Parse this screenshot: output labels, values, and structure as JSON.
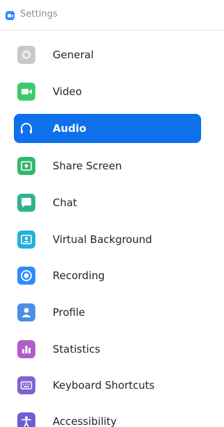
{
  "window": {
    "title": "Settings",
    "logo_icon": "zoom-camera-logo-icon"
  },
  "colors": {
    "accent": "#0e71eb",
    "general": "#c8c8c8",
    "video": "#3fc96a",
    "share_screen": "#33b96b",
    "chat": "#2fb38f",
    "virtual_background": "#24b0d8",
    "recording": "#2d8cff",
    "profile": "#4a90e2",
    "statistics": "#b05ec7",
    "keyboard_shortcuts": "#7f63d1",
    "accessibility": "#6c5fd0"
  },
  "sidebar": {
    "active_index": 2,
    "items": [
      {
        "label": "General",
        "icon": "gear-icon"
      },
      {
        "label": "Video",
        "icon": "video-camera-icon"
      },
      {
        "label": "Audio",
        "icon": "headphones-icon"
      },
      {
        "label": "Share Screen",
        "icon": "share-screen-icon"
      },
      {
        "label": "Chat",
        "icon": "chat-bubble-icon"
      },
      {
        "label": "Virtual Background",
        "icon": "virtual-background-icon"
      },
      {
        "label": "Recording",
        "icon": "record-icon"
      },
      {
        "label": "Profile",
        "icon": "profile-icon"
      },
      {
        "label": "Statistics",
        "icon": "bar-chart-icon"
      },
      {
        "label": "Keyboard Shortcuts",
        "icon": "keyboard-icon"
      },
      {
        "label": "Accessibility",
        "icon": "accessibility-icon"
      }
    ]
  }
}
